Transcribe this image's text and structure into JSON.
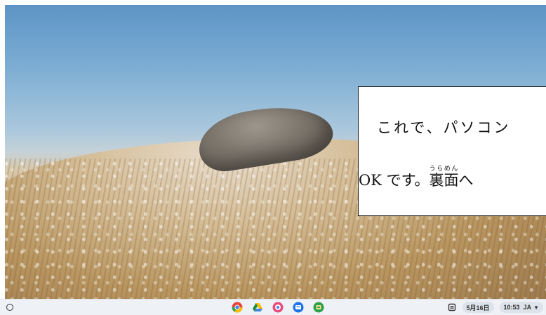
{
  "dialog": {
    "line1": "これで、パソコン",
    "line2_ok": "OK",
    "line2_desu": " です。",
    "ruby_base": "裏面",
    "ruby_reading": "うらめん",
    "line2_tail": "へ"
  },
  "shelf": {
    "apps": [
      {
        "name": "chrome-icon",
        "color": "#ea4335"
      },
      {
        "name": "drive-icon",
        "color": "#1e8e3e"
      },
      {
        "name": "photos-app-icon",
        "color": "#e94b7c"
      },
      {
        "name": "classroom-icon",
        "color": "#1a73e8"
      },
      {
        "name": "meet-app-icon",
        "color": "#2da149"
      }
    ]
  },
  "tray": {
    "date": "5月16日",
    "time": "10:53",
    "ime": "JA",
    "wifi_glyph": "▼"
  }
}
